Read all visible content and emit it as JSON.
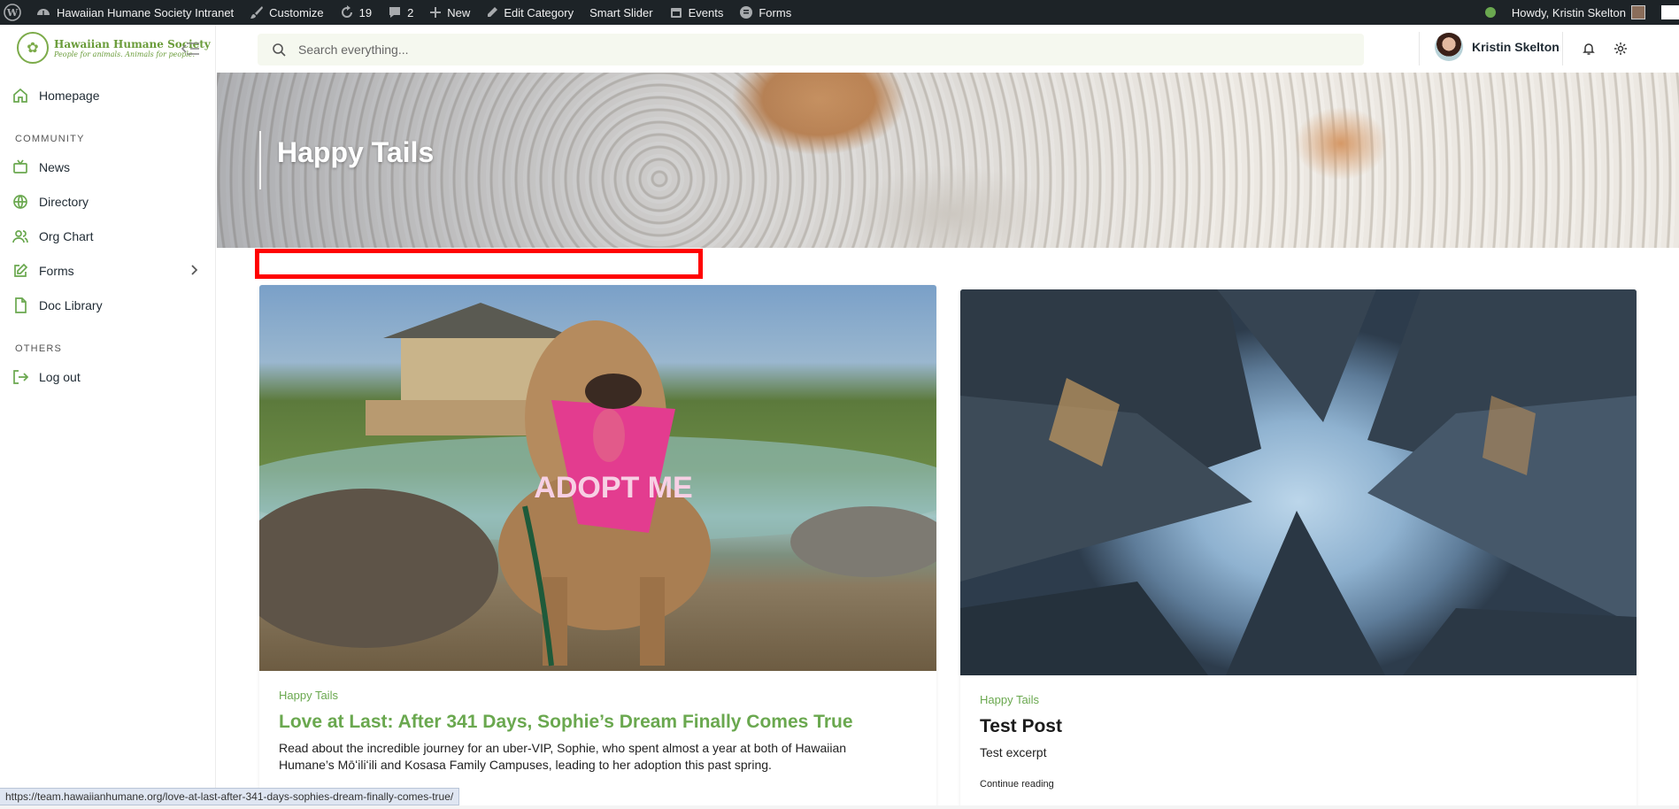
{
  "admin_bar": {
    "site_name": "Hawaiian Humane Society Intranet",
    "customize": "Customize",
    "updates_count": "19",
    "comments_count": "2",
    "new": "New",
    "edit_category": "Edit Category",
    "smart_slider": "Smart Slider",
    "events": "Events",
    "forms": "Forms",
    "howdy": "Howdy, Kristin Skelton"
  },
  "sidebar": {
    "logo_name": "Hawaiian Humane Society",
    "logo_tagline": "People for animals. Animals for people.",
    "items": [
      {
        "label": "Homepage",
        "icon": "home-icon"
      },
      {
        "label": "News",
        "icon": "tv-icon"
      },
      {
        "label": "Directory",
        "icon": "globe-icon"
      },
      {
        "label": "Org Chart",
        "icon": "users-icon"
      },
      {
        "label": "Forms",
        "icon": "edit-icon"
      },
      {
        "label": "Doc Library",
        "icon": "file-icon"
      },
      {
        "label": "Log out",
        "icon": "logout-icon"
      }
    ],
    "sections": {
      "community": "COMMUNITY",
      "others": "OTHERS"
    }
  },
  "header": {
    "search_placeholder": "Search everything...",
    "user_name": "Kristin Skelton"
  },
  "hero": {
    "title": "Happy Tails"
  },
  "posts": [
    {
      "category": "Happy Tails",
      "title": "Love at Last: After 341 Days, Sophie’s Dream Finally Comes True",
      "excerpt_line1": "Read about the incredible journey for an uber-VIP, Sophie, who spent almost a year at both of Hawaiian",
      "excerpt_line2": "Humane’s Mōʻiliʻili and Kosasa Family Campuses, leading to her adoption this past spring.",
      "image_text": "ADOPT ME"
    },
    {
      "category": "Happy Tails",
      "title": "Test Post",
      "excerpt": "Test excerpt",
      "read_more": "Continue reading"
    }
  ],
  "status_bar": {
    "url": "https://team.hawaiianhumane.org/love-at-last-after-341-days-sophies-dream-finally-comes-true/"
  },
  "colors": {
    "accent_green": "#6aa84f",
    "admin_bar": "#1d2327",
    "highlight_red": "#ff0000"
  }
}
